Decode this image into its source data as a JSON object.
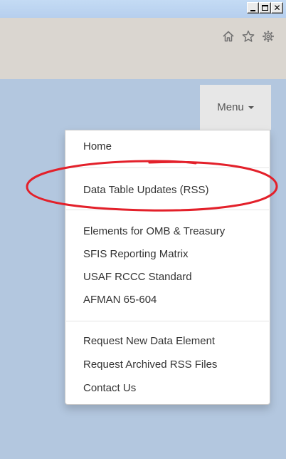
{
  "window": {
    "controls": [
      {
        "name": "minimize",
        "icon": "minimize-icon"
      },
      {
        "name": "maximize",
        "icon": "maximize-icon"
      },
      {
        "name": "close",
        "icon": "close-icon"
      }
    ]
  },
  "toolbar": {
    "icons": [
      "home-icon",
      "star-icon",
      "gear-icon"
    ]
  },
  "menu": {
    "button_label": "Menu",
    "items": [
      {
        "label": "Home"
      },
      {
        "label": "Data Table Updates (RSS)"
      },
      {
        "label": "Elements for OMB & Treasury"
      },
      {
        "label": "SFIS Reporting Matrix"
      },
      {
        "label": "USAF RCCC Standard"
      },
      {
        "label": "AFMAN 65-604"
      },
      {
        "label": "Request New Data Element"
      },
      {
        "label": "Request Archived RSS Files"
      },
      {
        "label": "Contact Us"
      }
    ]
  },
  "colors": {
    "page_background": "#b3c7df",
    "toolbar": "#dad6d0",
    "annotation": "#e3202a",
    "text": "#333333"
  }
}
